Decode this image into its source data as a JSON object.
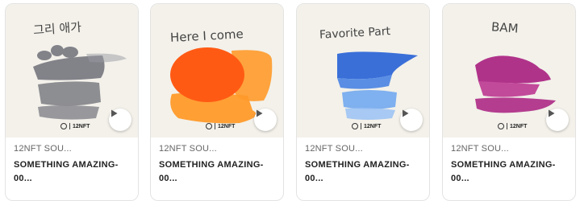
{
  "cards": [
    {
      "handwriting": "그리 애가",
      "collection": "12NFT SOU...",
      "title": "SOMETHING AMAZING-00...",
      "paint_color": "#6e6f78",
      "logo_text": "12NFT"
    },
    {
      "handwriting": "Here I come",
      "collection": "12NFT SOU...",
      "title": "SOMETHING AMAZING-00...",
      "paint_color": "#ff5a14",
      "paint_color_2": "#ff9a2a",
      "logo_text": "12NFT"
    },
    {
      "handwriting": "Favorite Part",
      "collection": "12NFT SOU...",
      "title": "SOMETHING AMAZING-00...",
      "paint_color": "#3a6fd8",
      "paint_color_2": "#7fb0ef",
      "logo_text": "12NFT"
    },
    {
      "handwriting": "BAM",
      "collection": "12NFT SOU...",
      "title": "SOMETHING AMAZING-00...",
      "paint_color": "#b0338a",
      "logo_text": "12NFT"
    }
  ]
}
